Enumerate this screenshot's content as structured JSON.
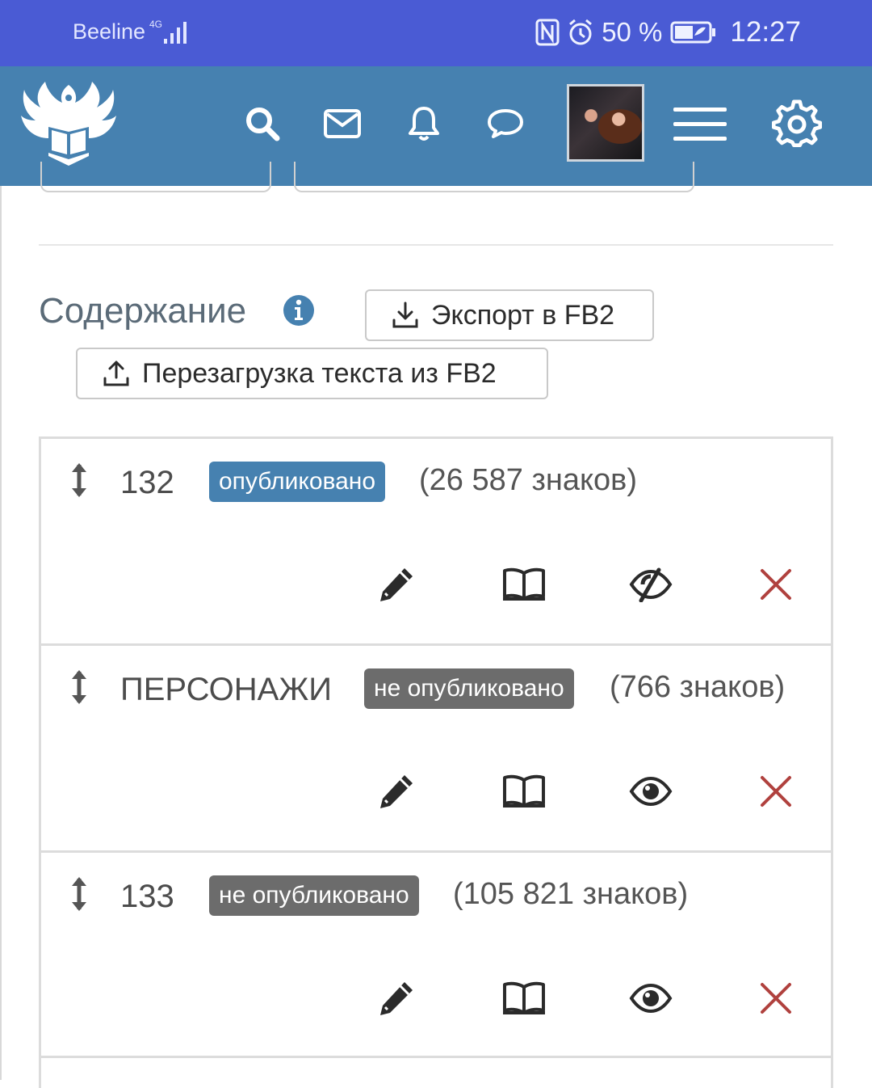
{
  "status_bar": {
    "carrier": "Beeline",
    "network": "4G",
    "battery": "50 %",
    "time": "12:27"
  },
  "navbar": {
    "icons": [
      "search-icon",
      "mail-icon",
      "bell-icon",
      "chat-icon",
      "menu-icon",
      "gear-icon"
    ]
  },
  "content": {
    "title": "Содержание",
    "export_label": "Экспорт в FB2",
    "reload_label": "Перезагрузка текста из FB2"
  },
  "chapters": [
    {
      "title": "132",
      "status": "опубликовано",
      "published": true,
      "count": "(26 587 знаков)"
    },
    {
      "title": "ПЕРСОНАЖИ",
      "status": "не опубликовано",
      "published": false,
      "count": "(766 знаков)"
    },
    {
      "title": "133",
      "status": "не опубликовано",
      "published": false,
      "count": "(105 821 знаков)"
    }
  ],
  "colors": {
    "status_bar": "#4a5bd4",
    "navbar": "#4681b0",
    "published_badge": "#4681b0",
    "unpublished_badge": "#6c6c6c",
    "delete": "#b0413e"
  }
}
